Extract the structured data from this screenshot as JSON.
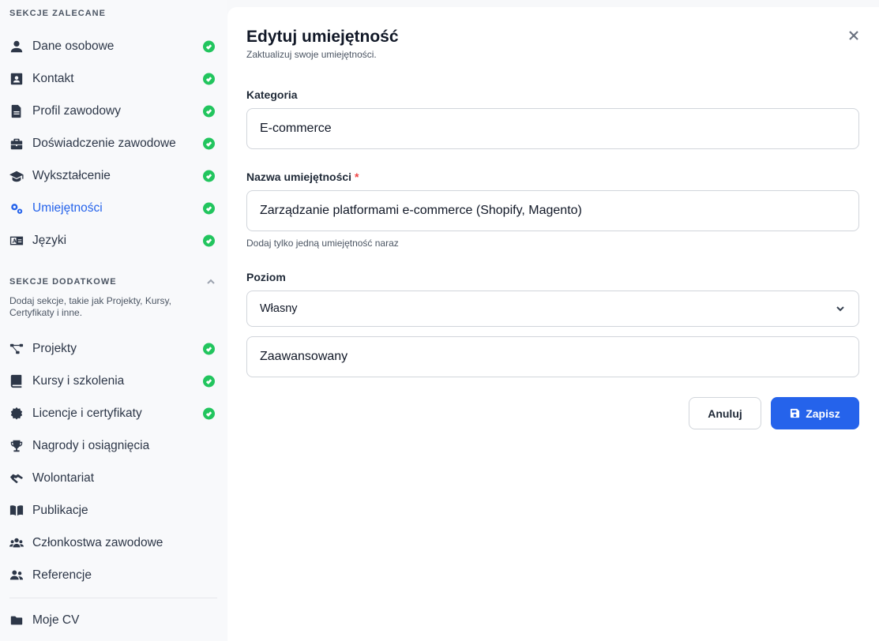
{
  "sidebar": {
    "recommended_title": "SEKCJE ZALECANE",
    "recommended": [
      {
        "label": "Dane osobowe",
        "icon": "user-icon",
        "done": true
      },
      {
        "label": "Kontakt",
        "icon": "contact-card-icon",
        "done": true
      },
      {
        "label": "Profil zawodowy",
        "icon": "document-icon",
        "done": true
      },
      {
        "label": "Doświadczenie zawodowe",
        "icon": "briefcase-icon",
        "done": true
      },
      {
        "label": "Wykształcenie",
        "icon": "graduation-cap-icon",
        "done": true
      },
      {
        "label": "Umiejętności",
        "icon": "gears-icon",
        "done": true,
        "active": true
      },
      {
        "label": "Języki",
        "icon": "language-icon",
        "done": true
      }
    ],
    "extra_title": "SEKCJE DODATKOWE",
    "extra_desc": "Dodaj sekcje, takie jak Projekty, Kursy, Certyfikaty i inne.",
    "extra": [
      {
        "label": "Projekty",
        "icon": "diagram-icon",
        "done": true
      },
      {
        "label": "Kursy i szkolenia",
        "icon": "book-icon",
        "done": true
      },
      {
        "label": "Licencje i certyfikaty",
        "icon": "certificate-icon",
        "done": true
      },
      {
        "label": "Nagrody i osiągnięcia",
        "icon": "trophy-icon",
        "done": false
      },
      {
        "label": "Wolontariat",
        "icon": "handshake-icon",
        "done": false
      },
      {
        "label": "Publikacje",
        "icon": "open-book-icon",
        "done": false
      },
      {
        "label": "Członkostwa zawodowe",
        "icon": "people-group-icon",
        "done": false
      },
      {
        "label": "Referencje",
        "icon": "people-icon",
        "done": false
      }
    ],
    "my_cv": "Moje CV"
  },
  "dialog": {
    "title": "Edytuj umiejętność",
    "subtitle": "Zaktualizuj swoje umiejętności.",
    "category_label": "Kategoria",
    "category_value": "E-commerce",
    "name_label": "Nazwa umiejętności",
    "required_mark": "*",
    "name_value": "Zarządzanie platformami e-commerce (Shopify, Magento)",
    "name_hint": "Dodaj tylko jedną umiejętność naraz",
    "level_label": "Poziom",
    "level_select": "Własny",
    "level_custom_value": "Zaawansowany",
    "cancel_label": "Anuluj",
    "save_label": "Zapisz"
  },
  "colors": {
    "accent": "#2563eb",
    "success": "#22c55e",
    "required": "#ef4444"
  }
}
